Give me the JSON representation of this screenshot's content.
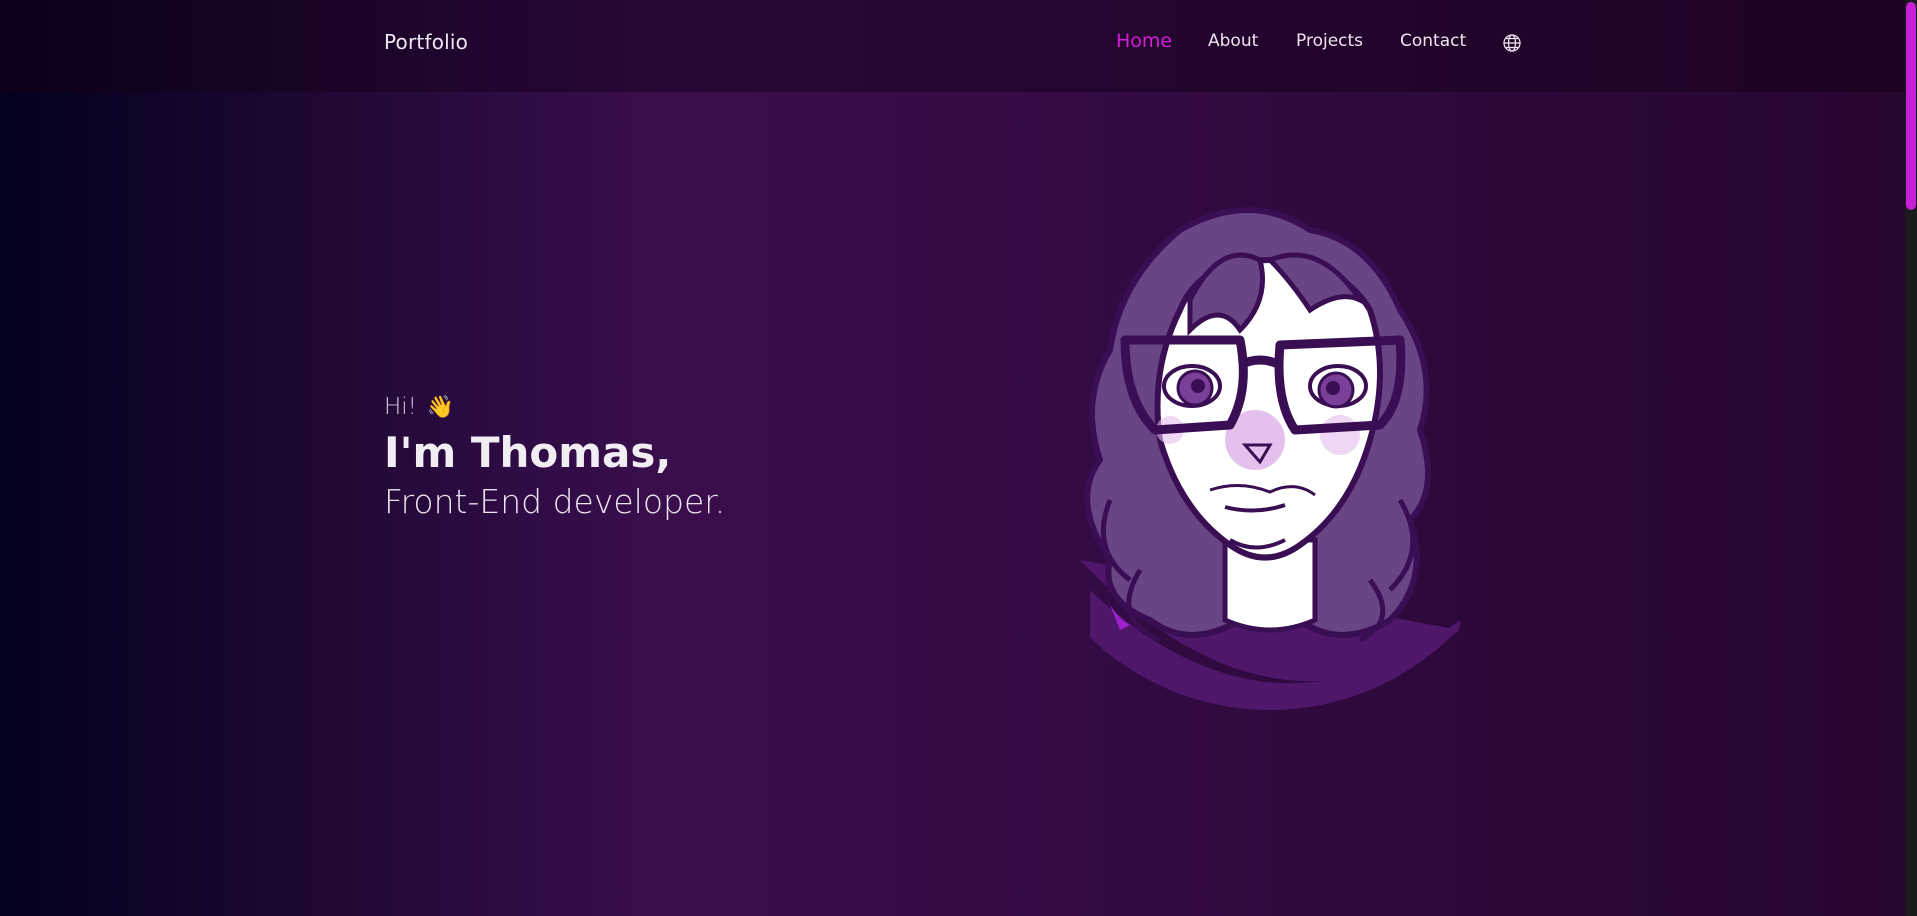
{
  "nav": {
    "brand": "Portfolio",
    "links": [
      {
        "label": "Home",
        "active": true
      },
      {
        "label": "About",
        "active": false
      },
      {
        "label": "Projects",
        "active": false
      },
      {
        "label": "Contact",
        "active": false
      }
    ],
    "language_icon": "globe-icon"
  },
  "hero": {
    "greeting": "Hi!",
    "greeting_icon": "waving-hand-icon",
    "name": "I'm Thomas,",
    "role": "Front-End developer."
  },
  "colors": {
    "accent": "#d21ed6",
    "background_dark": "#05001f",
    "background_purple": "#3a0e4c"
  }
}
